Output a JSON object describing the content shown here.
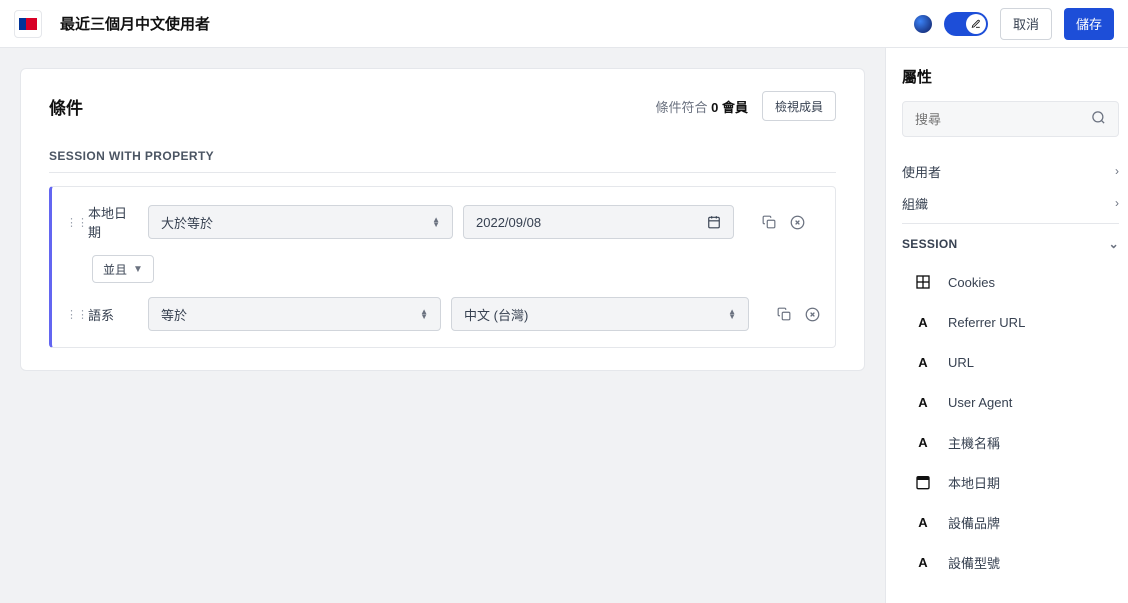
{
  "header": {
    "title": "最近三個月中文使用者",
    "cancel": "取消",
    "save": "儲存"
  },
  "card": {
    "title": "條件",
    "matchPrefix": "條件符合",
    "matchCount": "0",
    "matchUnit": "會員",
    "viewMembers": "檢視成員",
    "sectionLabel": "SESSION WITH PROPERTY"
  },
  "conditions": {
    "row1": {
      "field": "本地日期",
      "operator": "大於等於",
      "value": "2022/09/08"
    },
    "andLabel": "並且",
    "row2": {
      "field": "語系",
      "operator": "等於",
      "value": "中文 (台灣)"
    }
  },
  "sidebar": {
    "title": "屬性",
    "searchPlaceholder": "搜尋",
    "categories": {
      "user": "使用者",
      "org": "組織",
      "session": "SESSION"
    },
    "attrs": {
      "cookies": "Cookies",
      "referrer": "Referrer URL",
      "url": "URL",
      "ua": "User Agent",
      "host": "主機名稱",
      "localDate": "本地日期",
      "brand": "設備品牌",
      "model": "設備型號"
    }
  }
}
